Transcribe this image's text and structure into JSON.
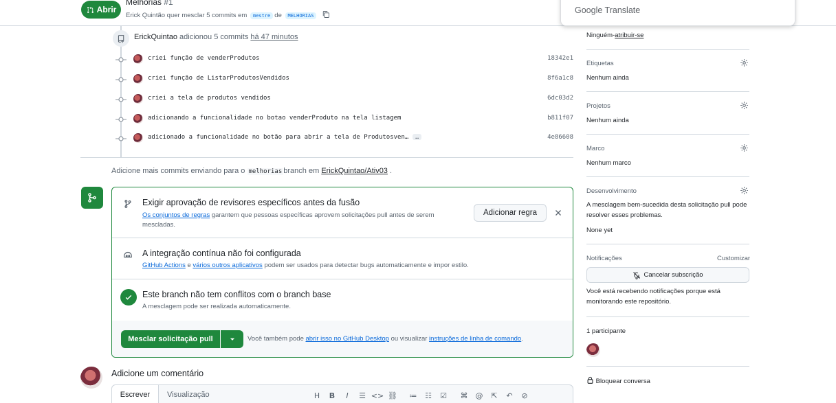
{
  "header": {
    "status_label": "Abrir",
    "pr_title": "Melhorias",
    "pr_number": "#1",
    "author": "Erick Quintão",
    "merge_text_1": "quer mesclar 5 commits em",
    "base_branch": "mestre",
    "merge_text_2": "de",
    "head_branch": "MELHORIAS"
  },
  "translate_popup": {
    "title": "Google Translate"
  },
  "timeline": {
    "pusher": "ErickQuintao",
    "push_action": "adicionou 5 commits",
    "push_time": "há 47 minutos",
    "commits": [
      {
        "message": "criei função de venderProdutos",
        "sha": "18342e1",
        "ellipsis": ""
      },
      {
        "message": "criei função de ListarProdutosVendidos",
        "sha": "8f6a1c8",
        "ellipsis": ""
      },
      {
        "message": "criei a tela de produtos vendidos",
        "sha": "6dc03d2",
        "ellipsis": ""
      },
      {
        "message": "adicionando a funcionalidade no botao venderProduto na tela listagem",
        "sha": "b811f07",
        "ellipsis": ""
      },
      {
        "message": "adicionado a funcionalidade no botão para abrir a tela de Produtosven…",
        "sha": "4e86608",
        "ellipsis": "…"
      }
    ],
    "add_more": {
      "prefix": "Adicione mais commits enviando para o",
      "branch": "melhorias",
      "middle": "branch em",
      "repo": "ErickQuintao/Ativ03",
      "suffix": "."
    }
  },
  "merge_box": {
    "rules": {
      "title": "Exigir aprovação de revisores específicos antes da fusão",
      "link": "Os conjuntos de regras",
      "desc": "garantem que pessoas específicas aprovem solicitações pull antes de serem mescladas.",
      "button": "Adicionar regra"
    },
    "ci": {
      "title": "A integração contínua não foi configurada",
      "link1": "GitHub Actions",
      "and": "e",
      "link2": "vários outros aplicativos",
      "desc": "podem ser usados para detectar bugs automaticamente e impor estilo."
    },
    "conflicts": {
      "title": "Este branch não tem conflitos com o branch base",
      "desc": "A mesclagem pode ser realizada automaticamente."
    },
    "footer": {
      "merge_button": "Mesclar solicitação pull",
      "also_text": "Você também pode",
      "link1": "abrir isso no GitHub Desktop",
      "or_text": "ou visualizar",
      "link2": "instruções de linha de comando",
      "end": "."
    }
  },
  "comment": {
    "heading": "Adicione um comentário",
    "tab_write": "Escrever",
    "tab_preview": "Visualização",
    "toolbar_icons": [
      "heading-icon",
      "bold-icon",
      "italic-icon",
      "quote-icon",
      "code-icon",
      "link-icon",
      "numbered-list-icon",
      "bulleted-list-icon",
      "task-list-icon",
      "attach-icon",
      "mention-icon",
      "reference-icon",
      "undo-icon",
      "slash-command-icon"
    ]
  },
  "sidebar": {
    "assignees_value": "Ninguém-",
    "assignees_link": "atribuir-se",
    "labels_title": "Etiquetas",
    "labels_value": "Nenhum ainda",
    "projects_title": "Projetos",
    "projects_value": "Nenhum ainda",
    "milestone_title": "Marco",
    "milestone_value": "Nenhum marco",
    "development_title": "Desenvolvimento",
    "development_desc": "A mesclagem bem-sucedida desta solicitação pull pode resolver esses problemas.",
    "development_value": "None yet",
    "notifications_title": "Notificações",
    "customize": "Customizar",
    "unsubscribe_button": "Cancelar subscrição",
    "notifications_desc": "Você está recebendo notificações porque está monitorando este repositório.",
    "participants": "1 participante",
    "lock": "Bloquear conversa"
  }
}
